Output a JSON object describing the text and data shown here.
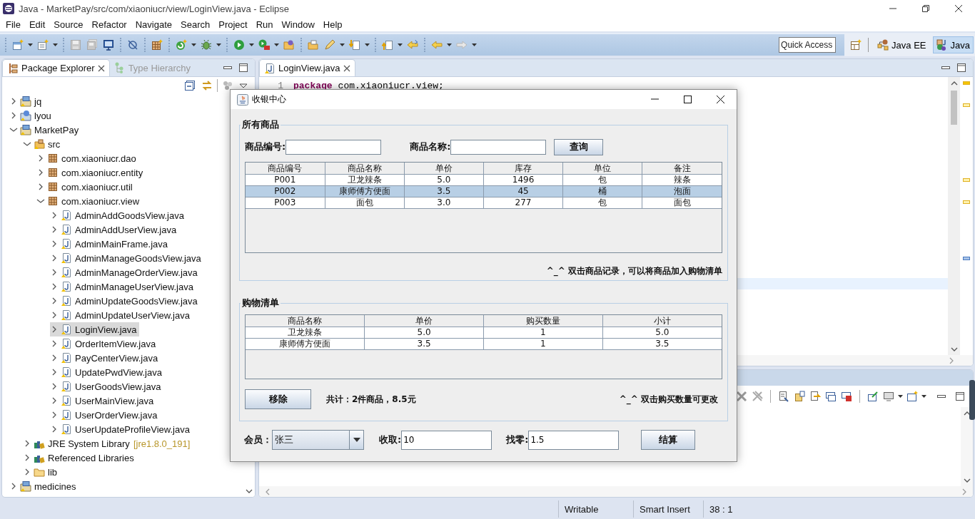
{
  "window": {
    "title": "Java - MarketPay/src/com/xiaoniucr/view/LoginView.java - Eclipse"
  },
  "menu": [
    "File",
    "Edit",
    "Source",
    "Refactor",
    "Navigate",
    "Search",
    "Project",
    "Run",
    "Window",
    "Help"
  ],
  "quick_access": {
    "placeholder": "Quick Access"
  },
  "perspectives": [
    {
      "label": "Java EE",
      "selected": false
    },
    {
      "label": "Java",
      "selected": true
    }
  ],
  "left_tabs": [
    {
      "label": "Package Explorer",
      "selected": true
    },
    {
      "label": "Type Hierarchy",
      "selected": false
    }
  ],
  "tree": [
    {
      "label": "jq",
      "kind": "project",
      "expanded": false,
      "selected": false
    },
    {
      "label": "lyou",
      "kind": "web-project",
      "expanded": false,
      "selected": false
    },
    {
      "label": "MarketPay",
      "kind": "project",
      "expanded": true,
      "selected": false,
      "children": [
        {
          "label": "src",
          "kind": "source-folder",
          "expanded": true,
          "selected": false,
          "children": [
            {
              "label": "com.xiaoniucr.dao",
              "kind": "package",
              "expanded": false,
              "selected": false
            },
            {
              "label": "com.xiaoniucr.entity",
              "kind": "package",
              "expanded": false,
              "selected": false
            },
            {
              "label": "com.xiaoniucr.util",
              "kind": "package",
              "expanded": false,
              "selected": false
            },
            {
              "label": "com.xiaoniucr.view",
              "kind": "package",
              "expanded": true,
              "selected": false,
              "children": [
                {
                  "label": "AdminAddGoodsView.java",
                  "kind": "java-file",
                  "expanded": false,
                  "selected": false
                },
                {
                  "label": "AdminAddUserView.java",
                  "kind": "java-file",
                  "expanded": false,
                  "selected": false
                },
                {
                  "label": "AdminMainFrame.java",
                  "kind": "java-file",
                  "expanded": false,
                  "selected": false
                },
                {
                  "label": "AdminManageGoodsView.java",
                  "kind": "java-file",
                  "expanded": false,
                  "selected": false
                },
                {
                  "label": "AdminManageOrderView.java",
                  "kind": "java-file",
                  "expanded": false,
                  "selected": false
                },
                {
                  "label": "AdminManageUserView.java",
                  "kind": "java-file",
                  "expanded": false,
                  "selected": false
                },
                {
                  "label": "AdminUpdateGoodsView.java",
                  "kind": "java-file",
                  "expanded": false,
                  "selected": false
                },
                {
                  "label": "AdminUpdateUserView.java",
                  "kind": "java-file",
                  "expanded": false,
                  "selected": false
                },
                {
                  "label": "LoginView.java",
                  "kind": "java-file",
                  "expanded": false,
                  "selected": true
                },
                {
                  "label": "OrderItemView.java",
                  "kind": "java-file",
                  "expanded": false,
                  "selected": false
                },
                {
                  "label": "PayCenterView.java",
                  "kind": "java-file",
                  "expanded": false,
                  "selected": false
                },
                {
                  "label": "UpdatePwdView.java",
                  "kind": "java-file",
                  "expanded": false,
                  "selected": false
                },
                {
                  "label": "UserGoodsView.java",
                  "kind": "java-file",
                  "expanded": false,
                  "selected": false
                },
                {
                  "label": "UserMainView.java",
                  "kind": "java-file",
                  "expanded": false,
                  "selected": false
                },
                {
                  "label": "UserOrderView.java",
                  "kind": "java-file",
                  "expanded": false,
                  "selected": false
                },
                {
                  "label": "UserUpdateProfileView.java",
                  "kind": "java-file",
                  "expanded": false,
                  "selected": false
                }
              ]
            }
          ]
        },
        {
          "label": "JRE System Library",
          "decoration": "[jre1.8.0_191]",
          "kind": "library",
          "expanded": false,
          "selected": false
        },
        {
          "label": "Referenced Libraries",
          "kind": "library",
          "expanded": false,
          "selected": false
        },
        {
          "label": "lib",
          "kind": "folder",
          "expanded": false,
          "selected": false
        }
      ]
    },
    {
      "label": "medicines",
      "kind": "project",
      "expanded": false,
      "selected": false
    }
  ],
  "editor": {
    "tabs": [
      {
        "label": "LoginView.java",
        "selected": true
      }
    ],
    "lines": [
      {
        "number": "1",
        "keyword": "package",
        "text": "com.xiaoniucr.view;"
      }
    ]
  },
  "status_bar": [
    "Writable",
    "Smart Insert",
    "38 : 1"
  ],
  "dialog": {
    "title": "收银中心",
    "goods_panel": {
      "title": "所有商品",
      "search_fields": [
        {
          "label": "商品编号:"
        },
        {
          "label": "商品名称:"
        }
      ],
      "search_button": "查询",
      "table": {
        "columns": [
          "商品编号",
          "商品名称",
          "单价",
          "库存",
          "单位",
          "备注"
        ],
        "rows": [
          {
            "cells": [
              "P001",
              "卫龙辣条",
              "5.0",
              "1496",
              "包",
              "辣条"
            ],
            "selected": false
          },
          {
            "cells": [
              "P002",
              "康师傅方便面",
              "3.5",
              "45",
              "桶",
              "泡面"
            ],
            "selected": true
          },
          {
            "cells": [
              "P003",
              "面包",
              "3.0",
              "277",
              "包",
              "面包"
            ],
            "selected": false
          }
        ]
      },
      "hint": "^_^ 双击商品记录，可以将商品加入购物清单"
    },
    "cart_panel": {
      "title": "购物清单",
      "table": {
        "columns": [
          "商品名称",
          "单价",
          "购买数量",
          "小计"
        ],
        "rows": [
          {
            "cells": [
              "卫龙辣条",
              "5.0",
              "1",
              "5.0"
            ],
            "selected": false
          },
          {
            "cells": [
              "康师傅方便面",
              "3.5",
              "1",
              "3.5"
            ],
            "selected": false
          }
        ]
      },
      "remove_button": "移除",
      "total": "共计：2件商品，8.5元",
      "hint": "^_^ 双击购买数量可更改"
    },
    "member": {
      "label": "会员：",
      "value": "张三"
    },
    "received": {
      "label": "收取:",
      "value": "10"
    },
    "change": {
      "label": "找零:",
      "value": "1.5"
    },
    "checkout_button": "结算"
  }
}
